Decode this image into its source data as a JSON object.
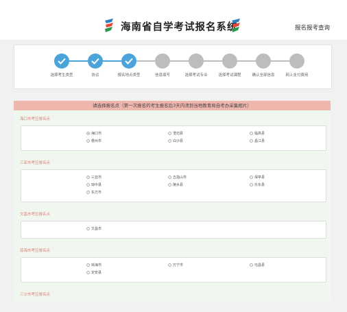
{
  "header": {
    "title": "海南省自学考试报名系统",
    "query_link": "报名报考查询"
  },
  "steps": [
    {
      "label": "选择考生类型",
      "status": "done"
    },
    {
      "label": "协议",
      "status": "done"
    },
    {
      "label": "报名地点类型",
      "status": "done"
    },
    {
      "label": "信息填写",
      "status": "todo"
    },
    {
      "label": "选择考试专业",
      "status": "todo"
    },
    {
      "label": "选择考试课程",
      "status": "todo"
    },
    {
      "label": "确认全部信息",
      "status": "todo"
    },
    {
      "label": "网上支付费用",
      "status": "todo"
    }
  ],
  "colors": {
    "accent": "#4aa3d9",
    "pending": "#bdbdbd",
    "notice_bg": "#efb6ae",
    "region_label": "#e07c7c"
  },
  "notice": "请选择报名点（第一次报名的考生报名后3天内须到当地教育局自考办采集相片）",
  "regions": [
    {
      "label": "海口市考区报名点",
      "options": [
        "海口市",
        "澄迈县",
        "临高县",
        "儋州市",
        "白沙县",
        "昌江县"
      ],
      "selected": "海口市"
    },
    {
      "label": "三亚市考区报名点",
      "options": [
        "三亚市",
        "五指山市",
        "保亭县",
        "琼中县",
        "陵水县",
        "乐东县",
        "东方市"
      ],
      "selected": ""
    },
    {
      "label": "文昌市考区报名点",
      "options": [
        "文昌市"
      ],
      "selected": ""
    },
    {
      "label": "琼海市考区报名点",
      "options": [
        "琼海市",
        "万宁市",
        "屯昌县",
        "定安县"
      ],
      "selected": ""
    },
    {
      "label": "三沙市考区报名点",
      "options": [],
      "selected": ""
    }
  ]
}
